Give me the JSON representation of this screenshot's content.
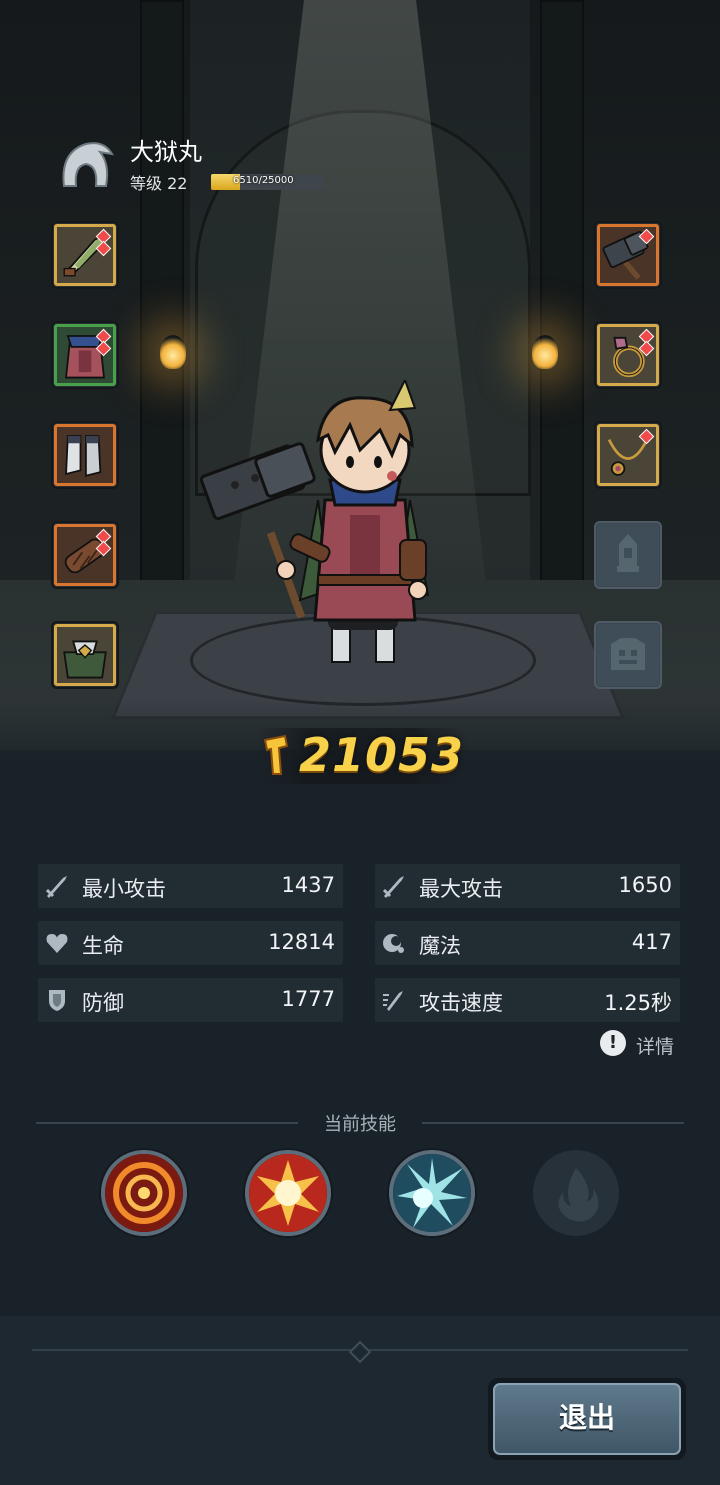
{
  "hero": {
    "name": "大狱丸",
    "level_label": "等级 22",
    "exp_text": "6510/25000",
    "exp_current": 6510,
    "exp_max": 25000,
    "class_icon": "hooded-helmet-icon"
  },
  "equipment": {
    "left": [
      {
        "item": "feather-dagger-icon",
        "rarity": "gold",
        "gems": 2
      },
      {
        "item": "scarf-tunic-icon",
        "rarity": "green",
        "gems": 2
      },
      {
        "item": "boots-icon",
        "rarity": "orange",
        "gems": 0
      },
      {
        "item": "bracer-icon",
        "rarity": "orange",
        "gems": 2
      },
      {
        "item": "shoulder-armor-icon",
        "rarity": "gold",
        "gems": 0
      }
    ],
    "right": [
      {
        "item": "war-hammer-icon",
        "rarity": "orange",
        "gems": 1
      },
      {
        "item": "ring-icon",
        "rarity": "gold",
        "gems": 2
      },
      {
        "item": "necklace-icon",
        "rarity": "gold",
        "gems": 1
      },
      {
        "item": "lantern-slot-icon",
        "rarity": "empty",
        "gems": 0
      },
      {
        "item": "pet-slot-icon",
        "rarity": "empty",
        "gems": 0
      }
    ]
  },
  "power": {
    "value": "21053",
    "icon": "hammer-power-icon"
  },
  "stats": [
    {
      "label": "最小攻击",
      "value": "1437",
      "icon": "sword-icon"
    },
    {
      "label": "最大攻击",
      "value": "1650",
      "icon": "sword-icon"
    },
    {
      "label": "生命",
      "value": "12814",
      "icon": "heart-icon"
    },
    {
      "label": "魔法",
      "value": "417",
      "icon": "magic-icon"
    },
    {
      "label": "防御",
      "value": "1777",
      "icon": "shield-icon"
    },
    {
      "label": "攻击速度",
      "value": "1.25秒",
      "icon": "attack-speed-icon"
    }
  ],
  "details_label": "详情",
  "skills": {
    "title": "当前技能",
    "items": [
      {
        "icon": "fire-vortex-skill-icon",
        "active": true
      },
      {
        "icon": "explosion-skill-icon",
        "active": true
      },
      {
        "icon": "ice-blast-skill-icon",
        "active": true
      },
      {
        "icon": "flame-skill-icon",
        "active": false
      }
    ]
  },
  "exit_label": "退出",
  "colors": {
    "power_gold": "#f7d24a",
    "rarity_gold": "#d4aa4a",
    "rarity_green": "#49a04b",
    "rarity_orange": "#d8752f",
    "exp_fill": "#e0ad26"
  }
}
